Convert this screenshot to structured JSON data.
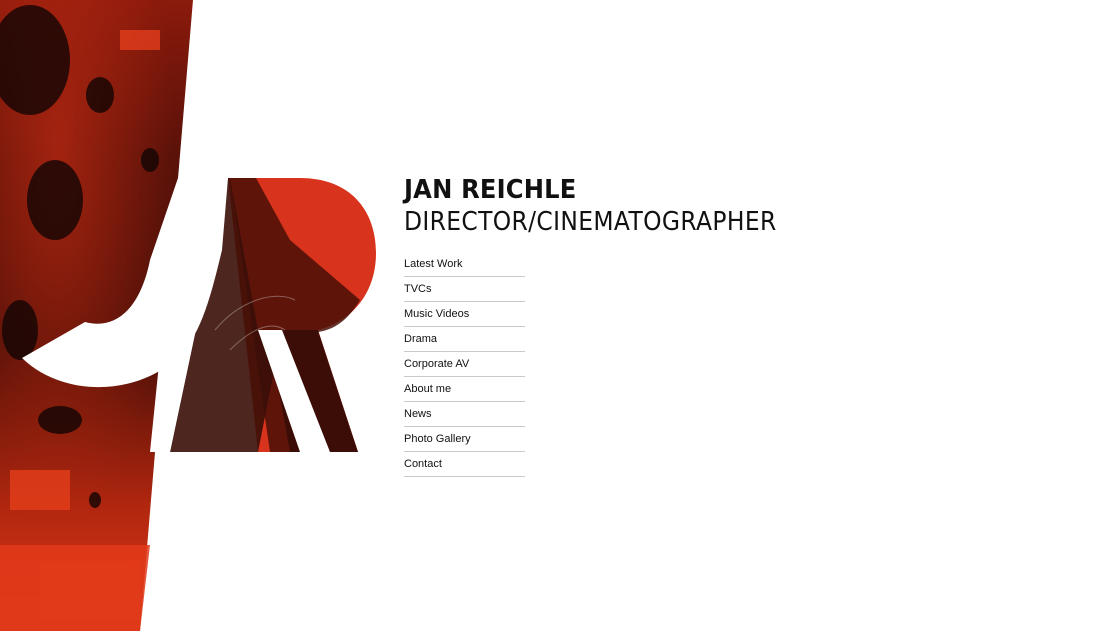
{
  "brand": {
    "name": "JAN REICHLE",
    "role": "DIRECTOR/CINEMATOGRAPHER"
  },
  "logo": {
    "icon": "jr-monogram-logo",
    "colors": {
      "red": "#d8331c",
      "dark": "#3a0e08",
      "black": "#120504"
    }
  },
  "nav": {
    "items": [
      {
        "label": "Latest Work"
      },
      {
        "label": "TVCs"
      },
      {
        "label": "Music Videos"
      },
      {
        "label": "Drama"
      },
      {
        "label": "Corporate AV"
      },
      {
        "label": "About me"
      },
      {
        "label": "News"
      },
      {
        "label": "Photo Gallery"
      },
      {
        "label": "Contact"
      }
    ]
  }
}
